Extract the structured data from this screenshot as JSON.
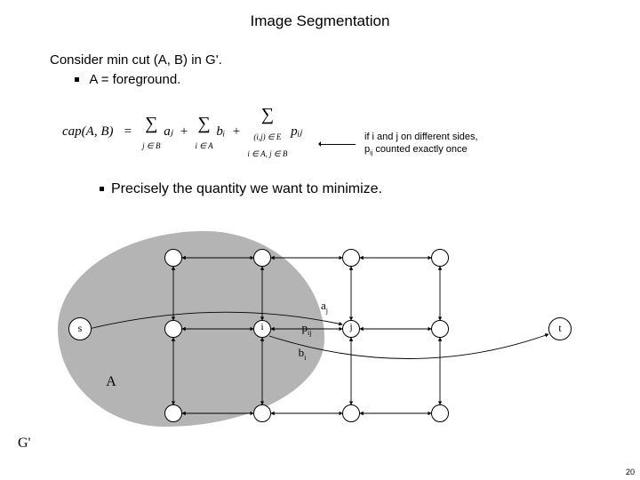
{
  "title": "Image Segmentation",
  "line1": "Consider min cut (A, B) in G'.",
  "bullet1": "A = foreground.",
  "formula": {
    "lhs": "cap(A, B)",
    "eq": "=",
    "t1_top": "∑",
    "t1_bot": "j ∈ B",
    "t1_body": "aⱼ",
    "plus1": "+",
    "t2_top": "∑",
    "t2_bot": "i ∈ A",
    "t2_body": "bᵢ",
    "plus2": "+",
    "t3_top": "∑",
    "t3_bot1": "(i,j) ∈ E",
    "t3_bot2": "i ∈ A, j ∈ B",
    "t3_body": "pᵢⱼ"
  },
  "note_line1": "if i and j on different sides,",
  "note_line2": "pij counted exactly once",
  "bullet2": "Precisely the quantity we want to minimize.",
  "labels": {
    "s": "s",
    "t": "t",
    "i": "i",
    "j": "j",
    "aj": "aⱼ",
    "pij": "pᵢⱼ",
    "bi": "bᵢ",
    "A": "A",
    "Gp": "G'"
  },
  "page": "20"
}
